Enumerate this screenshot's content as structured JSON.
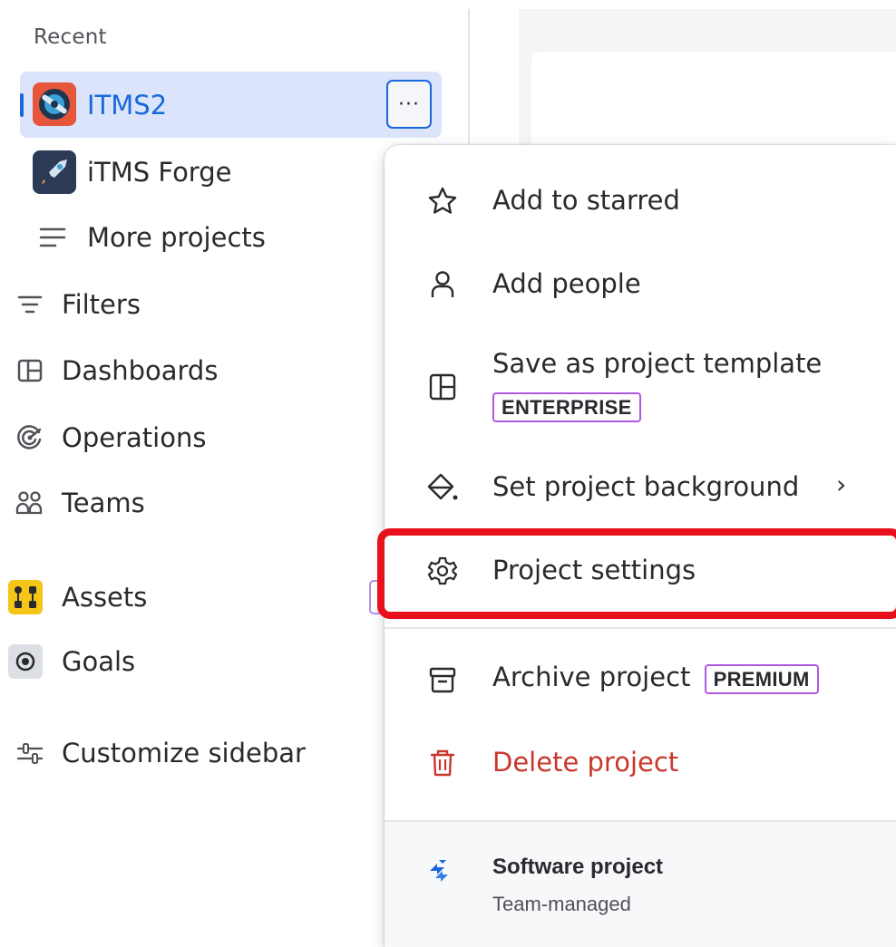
{
  "sidebar": {
    "recent_heading": "Recent",
    "projects": [
      {
        "name": "ITMS2",
        "selected": true,
        "more_label": "···"
      },
      {
        "name": "iTMS Forge",
        "selected": false
      }
    ],
    "more_projects": "More projects",
    "nav_items": [
      {
        "label": "Filters",
        "icon": "filter-icon"
      },
      {
        "label": "Dashboards",
        "icon": "dashboard-icon"
      },
      {
        "label": "Operations",
        "icon": "operations-icon"
      },
      {
        "label": "Teams",
        "icon": "teams-icon"
      },
      {
        "label": "Assets",
        "icon": "assets-icon"
      },
      {
        "label": "Goals",
        "icon": "goals-icon"
      },
      {
        "label": "Customize sidebar",
        "icon": "customize-icon"
      }
    ]
  },
  "menu": {
    "add_to_starred": "Add to starred",
    "add_people": "Add people",
    "save_template": "Save as project template",
    "enterprise_badge": "ENTERPRISE",
    "set_background": "Set project background",
    "project_settings": "Project settings",
    "archive_project": "Archive project",
    "premium_badge": "PREMIUM",
    "delete_project": "Delete project",
    "footer_title": "Software project",
    "footer_subtitle": "Team-managed"
  },
  "colors": {
    "accent": "#1868db",
    "selected_bg": "#dbe4fb",
    "danger": "#c9372c",
    "highlight": "#e8101a",
    "lozenge_border": "#af59e1"
  }
}
